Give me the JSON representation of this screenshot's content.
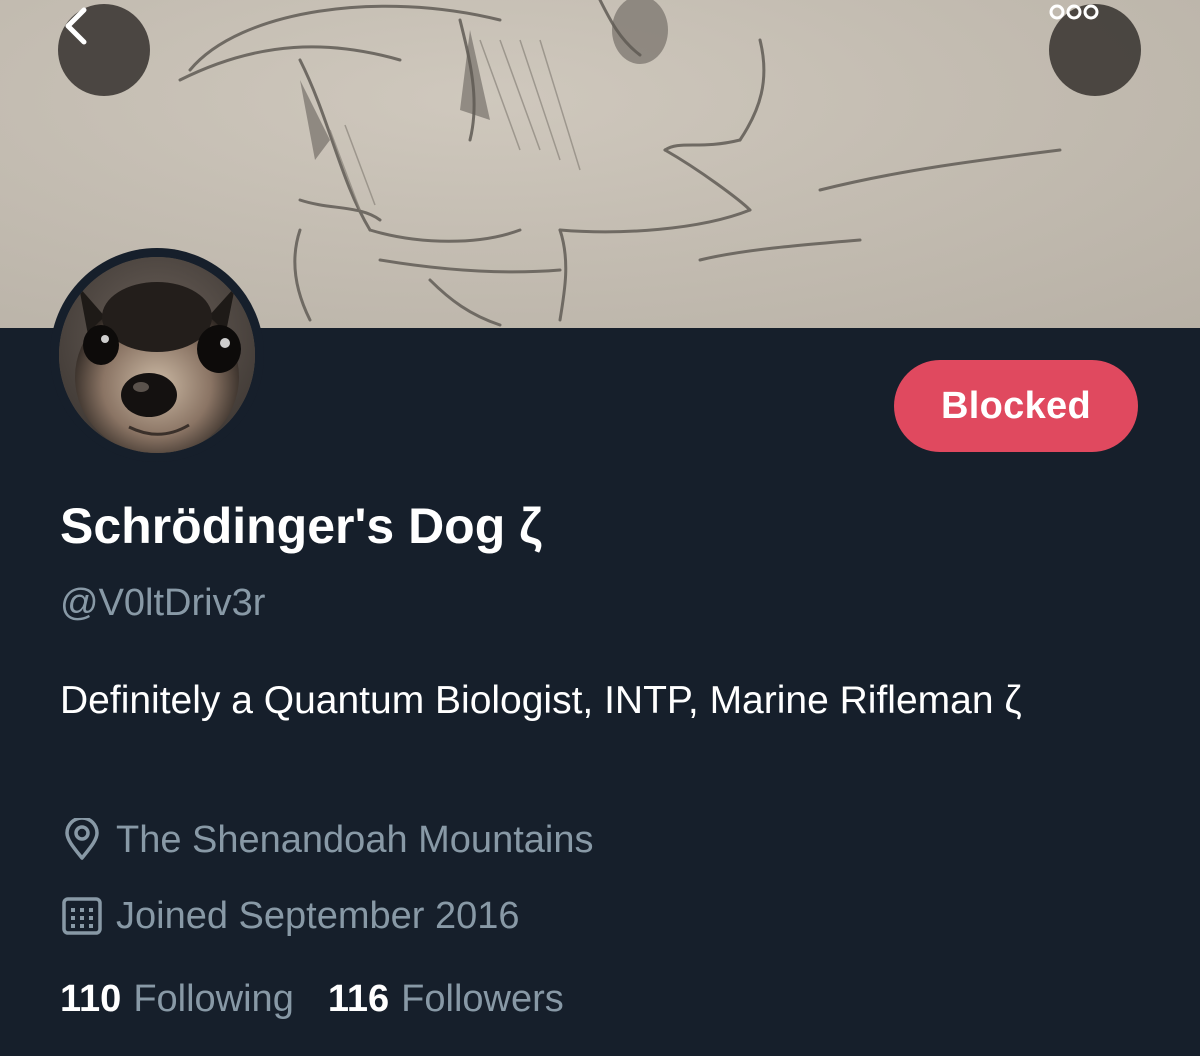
{
  "profile": {
    "display_name": "Schrödinger's Dog ζ",
    "handle": "@V0ltDriv3r",
    "bio": "Definitely a Quantum Biologist, INTP, Marine Rifleman ζ",
    "location": "The Shenandoah Mountains",
    "joined": "Joined September 2016",
    "following_count": "110",
    "following_label": "Following",
    "followers_count": "116",
    "followers_label": "Followers"
  },
  "actions": {
    "blocked_label": "Blocked"
  },
  "icons": {
    "back": "chevron-left-icon",
    "more": "more-dots-icon",
    "location": "map-pin-icon",
    "calendar": "calendar-icon"
  },
  "colors": {
    "background": "#161f2b",
    "blocked_button": "#e0495f",
    "secondary_text": "#8899a6",
    "primary_text": "#ffffff"
  }
}
